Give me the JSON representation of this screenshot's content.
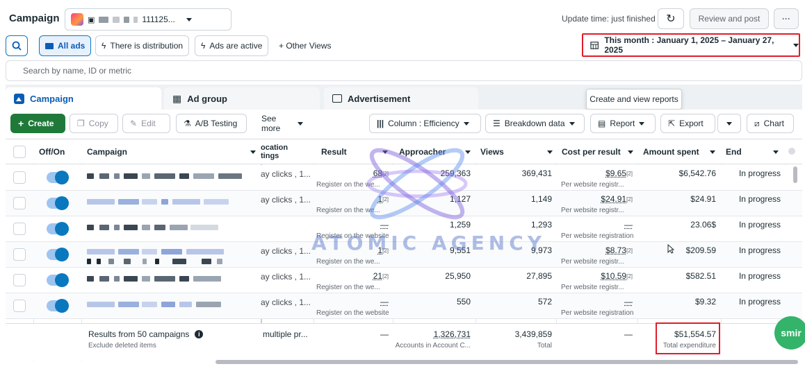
{
  "header": {
    "title": "Campaign",
    "account_number": "111125...",
    "update_time": "Update time: just finished",
    "review_label": "Review and post",
    "more_label": "···"
  },
  "views": {
    "all_ads": "All ads",
    "distribution": "There is distribution",
    "active": "Ads are active",
    "other": "+ Other Views",
    "date_range": "This month : January 1, 2025 – January 27, 2025"
  },
  "search": {
    "placeholder": "Search by name, ID or metric"
  },
  "tabs": {
    "campaign": "Campaign",
    "ad_group": "Ad group",
    "advertisement": "Advertisement",
    "tooltip": "Create and view reports"
  },
  "toolbar": {
    "create": "Create",
    "copy": "Copy",
    "edit": "Edit",
    "ab_testing": "A/B Testing",
    "see_more": "See more",
    "column": "Column : Efficiency",
    "breakdown": "Breakdown data",
    "report": "Report",
    "export": "Export",
    "chart": "Chart"
  },
  "columns": {
    "offon": "Off/On",
    "campaign": "Campaign",
    "location": "ocation\ntings",
    "result": "Result",
    "approacher": "Approacher",
    "views": "Views",
    "cost": "Cost per result",
    "amount": "Amount spent",
    "end": "End"
  },
  "rows": [
    {
      "bid": "ay clicks , 1...",
      "result": "68",
      "result_sup": "[2]",
      "result_sub": "Register on the we...",
      "approacher": "259,363",
      "views": "369,431",
      "cost": "$9.65",
      "cost_sup": "[2]",
      "cost_sub": "Per website registr...",
      "amount": "$6,542.76",
      "end": "In progress"
    },
    {
      "bid": "ay clicks , 1...",
      "result": "1",
      "result_sup": "[2]",
      "result_sub": "Register on the we...",
      "approacher": "1,127",
      "views": "1,149",
      "cost": "$24.91",
      "cost_sup": "[2]",
      "cost_sub": "Per website registr...",
      "amount": "$24.91",
      "end": "In progress"
    },
    {
      "bid": "",
      "result": "—",
      "result_sup": "",
      "result_sub": "Register on the website",
      "approacher": "1,259",
      "views": "1,293",
      "cost": "—",
      "cost_sup": "",
      "cost_sub": "Per website registration",
      "amount": "23.06$",
      "end": "In progress"
    },
    {
      "bid": "ay clicks , 1...",
      "result": "1",
      "result_sup": "[2]",
      "result_sub": "Register on the we...",
      "approacher": "9,551",
      "views": "9,973",
      "cost": "$8.73",
      "cost_sup": "[2]",
      "cost_sub": "Per website registr...",
      "amount": "$209.59",
      "end": "In progress"
    },
    {
      "bid": "ay clicks , 1...",
      "result": "21",
      "result_sup": "[2]",
      "result_sub": "Register on the we...",
      "approacher": "25,950",
      "views": "27,895",
      "cost": "$10.59",
      "cost_sup": "[2]",
      "cost_sub": "Per website registr...",
      "amount": "$582.51",
      "end": "In progress"
    },
    {
      "bid": "ay clicks , 1...",
      "result": "—",
      "result_sup": "",
      "result_sub": "Register on the website",
      "approacher": "550",
      "views": "572",
      "cost": "—",
      "cost_sup": "",
      "cost_sub": "Per website registration",
      "amount": "$9.32",
      "end": "In progress"
    }
  ],
  "total": {
    "label": "Results from 50 campaigns",
    "sub": "Exclude deleted items",
    "bid": "multiple pr...",
    "result": "—",
    "approacher": "1,326,731",
    "approacher_sub": "Accounts in Account C...",
    "views": "3,439,859",
    "views_sub": "Total",
    "cost": "—",
    "amount": "$51,554.57",
    "amount_sub": "Total expenditure"
  },
  "watermark": "ATOMIC AGENCY",
  "chat_label": "smir",
  "colors": {
    "accent": "#0a78be",
    "create": "#1f7a3a",
    "highlight": "#e01d2a"
  }
}
